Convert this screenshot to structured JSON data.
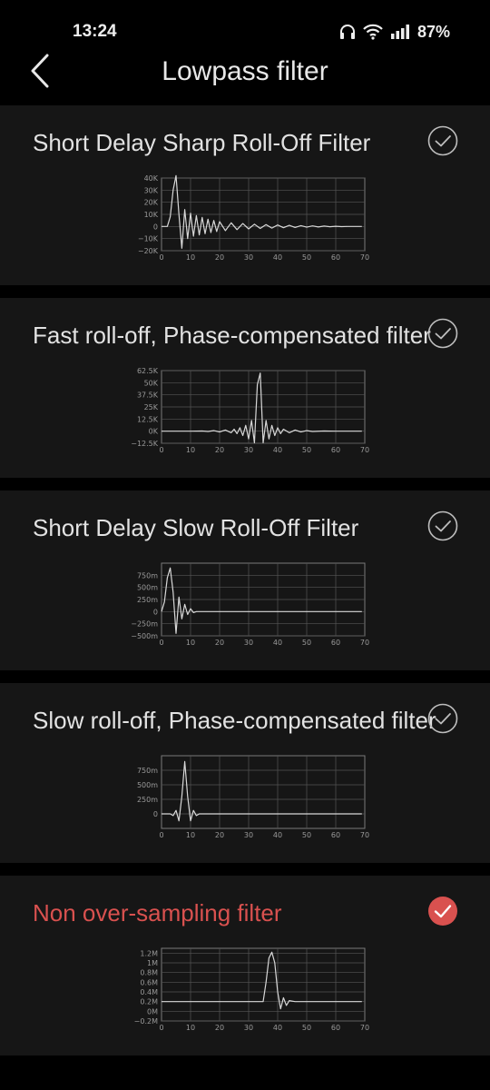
{
  "status": {
    "time": "13:24",
    "battery": "87%"
  },
  "header": {
    "title": "Lowpass filter"
  },
  "colors": {
    "accent": "#d9514f",
    "card": "#161616",
    "background": "#000000",
    "trace": "#d8d8d8"
  },
  "icons": {
    "back": "chevron-left-icon",
    "check": "check-circle-icon",
    "status": [
      "headphones-icon",
      "wifi-icon",
      "signal-icon"
    ]
  },
  "filters": [
    {
      "label": "Short Delay Sharp Roll-Off Filter",
      "selected": false,
      "chart_data": {
        "type": "line",
        "title": "",
        "xlabel": "",
        "ylabel": "",
        "xlim": [
          0,
          70
        ],
        "ylim": [
          -20000,
          40000
        ],
        "x_ticks": [
          "0",
          "10",
          "20",
          "30",
          "40",
          "50",
          "60",
          "70"
        ],
        "y_ticks": [
          "40K",
          "30K",
          "20K",
          "10K",
          "0",
          "−10K",
          "−20K"
        ],
        "y_tick_values": [
          40000,
          30000,
          20000,
          10000,
          0,
          -10000,
          -20000
        ],
        "grid": true,
        "series": [
          {
            "x": [
              0,
              2,
              3,
              4,
              5,
              6,
              7,
              8,
              9,
              10,
              11,
              12,
              13,
              14,
              15,
              16,
              17,
              18,
              19,
              20,
              22,
              24,
              26,
              28,
              30,
              32,
              34,
              36,
              38,
              40,
              42,
              44,
              46,
              48,
              50,
              52,
              54,
              56,
              58,
              60,
              62,
              64,
              66,
              68,
              69
            ],
            "y": [
              0,
              0,
              8000,
              30000,
              42000,
              10000,
              -18000,
              14000,
              -10000,
              11000,
              -8000,
              9000,
              -7000,
              7500,
              -6000,
              6000,
              -5000,
              5000,
              -4200,
              4000,
              -3400,
              3000,
              -2600,
              2400,
              -2000,
              1900,
              -1600,
              1500,
              -1300,
              1200,
              -1000,
              900,
              -800,
              700,
              -600,
              500,
              -400,
              300,
              -200,
              150,
              -100,
              50,
              0,
              0,
              0
            ]
          }
        ]
      }
    },
    {
      "label": "Fast roll-off, Phase-compensated filter",
      "selected": false,
      "chart_data": {
        "type": "line",
        "title": "",
        "xlabel": "",
        "ylabel": "",
        "xlim": [
          0,
          70
        ],
        "ylim": [
          -12500,
          62500
        ],
        "x_ticks": [
          "0",
          "10",
          "20",
          "30",
          "40",
          "50",
          "60",
          "70"
        ],
        "y_ticks": [
          "62.5K",
          "50K",
          "37.5K",
          "25K",
          "12.5K",
          "0K",
          "−12.5K"
        ],
        "y_tick_values": [
          62500,
          50000,
          37500,
          25000,
          12500,
          0,
          -12500
        ],
        "grid": true,
        "series": [
          {
            "x": [
              0,
              10,
              14,
              16,
              18,
              20,
              22,
              24,
              25,
              26,
              27,
              28,
              29,
              30,
              31,
              32,
              33,
              34,
              35,
              36,
              37,
              38,
              39,
              40,
              41,
              42,
              44,
              46,
              48,
              50,
              52,
              56,
              60,
              69
            ],
            "y": [
              0,
              0,
              200,
              -300,
              500,
              -800,
              1200,
              -1600,
              2000,
              -2600,
              3500,
              -4500,
              6000,
              -8000,
              11000,
              -12000,
              48000,
              60000,
              -12000,
              11000,
              -8000,
              6000,
              -4500,
              3500,
              -2600,
              2000,
              -1600,
              1200,
              -800,
              500,
              -300,
              200,
              0,
              0
            ]
          }
        ]
      }
    },
    {
      "label": "Short Delay Slow Roll-Off Filter",
      "selected": false,
      "chart_data": {
        "type": "line",
        "title": "",
        "xlabel": "",
        "ylabel": "",
        "xlim": [
          0,
          70
        ],
        "ylim": [
          -500,
          1000
        ],
        "x_ticks": [
          "0",
          "10",
          "20",
          "30",
          "40",
          "50",
          "60",
          "70"
        ],
        "y_ticks": [
          "750m",
          "500m",
          "250m",
          "0",
          "−250m",
          "−500m"
        ],
        "y_tick_values": [
          750,
          500,
          250,
          0,
          -250,
          -500
        ],
        "grid": true,
        "series": [
          {
            "x": [
              0,
              1,
              2,
              3,
              4,
              5,
              6,
              7,
              8,
              9,
              10,
              11,
              12,
              14,
              20,
              40,
              69
            ],
            "y": [
              0,
              200,
              700,
              900,
              400,
              -450,
              300,
              -150,
              150,
              -60,
              60,
              -20,
              0,
              0,
              0,
              0,
              0
            ]
          }
        ]
      }
    },
    {
      "label": "Slow roll-off, Phase-compensated filter",
      "selected": false,
      "chart_data": {
        "type": "line",
        "title": "",
        "xlabel": "",
        "ylabel": "",
        "xlim": [
          0,
          70
        ],
        "ylim": [
          -250,
          1000
        ],
        "x_ticks": [
          "0",
          "10",
          "20",
          "30",
          "40",
          "50",
          "60",
          "70"
        ],
        "y_ticks": [
          "750m",
          "500m",
          "250m",
          "0"
        ],
        "y_tick_values": [
          750,
          500,
          250,
          0
        ],
        "grid": true,
        "series": [
          {
            "x": [
              0,
              3,
              4,
              5,
              6,
              7,
              8,
              9,
              10,
              11,
              12,
              13,
              14,
              20,
              40,
              69
            ],
            "y": [
              0,
              0,
              -30,
              60,
              -120,
              300,
              900,
              300,
              -120,
              60,
              -30,
              0,
              0,
              0,
              0,
              0
            ]
          }
        ]
      }
    },
    {
      "label": "Non over-sampling filter",
      "selected": true,
      "chart_data": {
        "type": "line",
        "title": "",
        "xlabel": "",
        "ylabel": "",
        "xlim": [
          0,
          70
        ],
        "ylim": [
          -0.2,
          1.3
        ],
        "x_ticks": [
          "0",
          "10",
          "20",
          "30",
          "40",
          "50",
          "60",
          "70"
        ],
        "y_ticks": [
          "1.2M",
          "1M",
          "0.8M",
          "0.6M",
          "0.4M",
          "0.2M",
          "0M",
          "−0.2M"
        ],
        "y_tick_values": [
          1.2,
          1.0,
          0.8,
          0.6,
          0.4,
          0.2,
          0,
          -0.2
        ],
        "grid": true,
        "series": [
          {
            "x": [
              0,
              35,
              36,
              37,
              38,
              39,
              40,
              41,
              42,
              43,
              44,
              46,
              50,
              69
            ],
            "y": [
              0.2,
              0.2,
              0.6,
              1.1,
              1.22,
              1.0,
              0.4,
              0.05,
              0.28,
              0.12,
              0.22,
              0.2,
              0.2,
              0.2
            ]
          }
        ]
      }
    }
  ]
}
